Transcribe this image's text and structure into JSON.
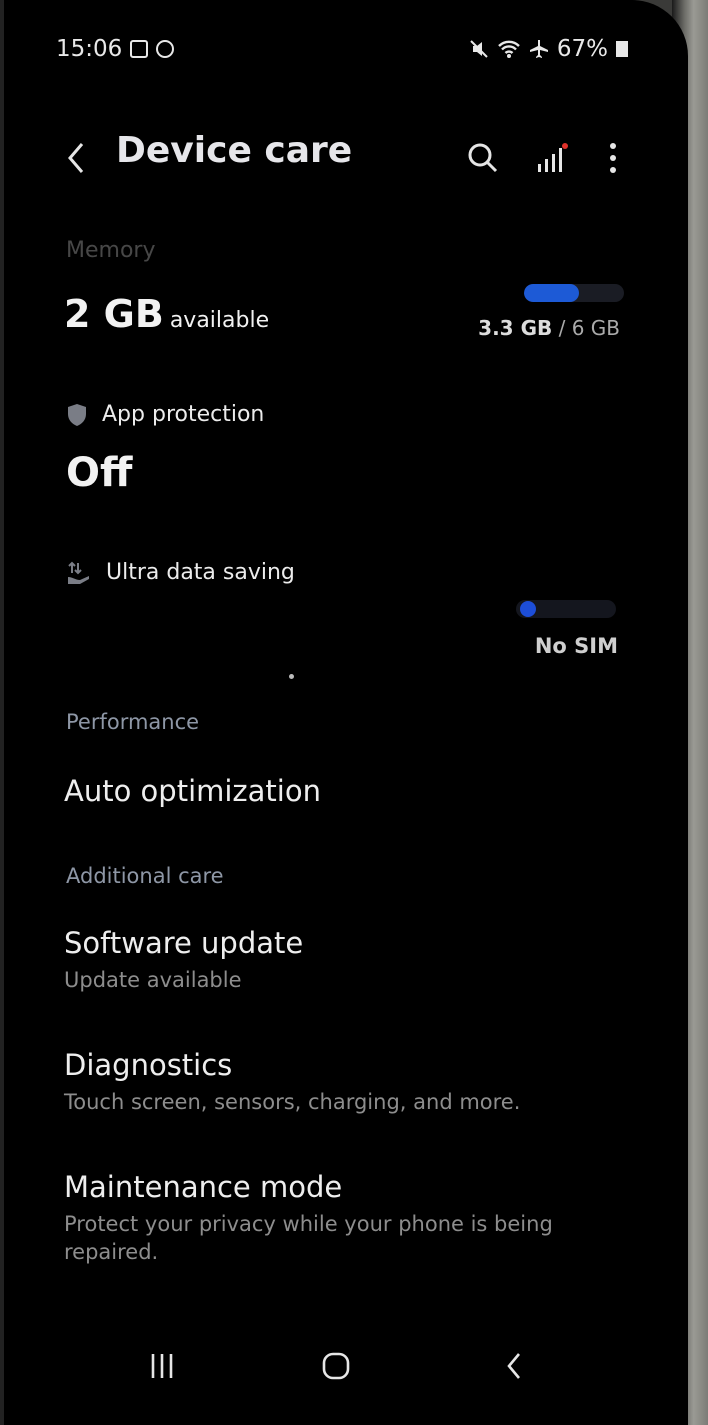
{
  "status_bar": {
    "time": "15:06",
    "battery": "67%",
    "icons": [
      "gallery-notification-icon",
      "circle-notification-icon",
      "mute-icon",
      "wifi-icon",
      "airplane-icon",
      "battery-icon"
    ]
  },
  "app_bar": {
    "title": "Device care",
    "icons": [
      "back-icon",
      "search-icon",
      "signal-icon",
      "more-vert-icon"
    ]
  },
  "memory": {
    "label": "Memory",
    "value": "2 GB",
    "value_suffix": "available",
    "used": "3.3 GB",
    "total": "6 GB",
    "fraction_used": 0.55,
    "accent": "#1d5ad6"
  },
  "app_protection": {
    "label": "App protection",
    "status": "Off"
  },
  "ultra_data_saving": {
    "label": "Ultra data saving",
    "sim_status": "No SIM"
  },
  "performance": {
    "header": "Performance",
    "auto_optimization": "Auto optimization"
  },
  "additional_care": {
    "header": "Additional care",
    "items": [
      {
        "title": "Software update",
        "subtitle": "Update available"
      },
      {
        "title": "Diagnostics",
        "subtitle": "Touch screen, sensors, charging, and more."
      },
      {
        "title": "Maintenance mode",
        "subtitle": "Protect your privacy while your phone is being repaired."
      }
    ]
  },
  "nav_bar": {
    "icons": [
      "recents-icon",
      "home-icon",
      "back-icon"
    ]
  }
}
